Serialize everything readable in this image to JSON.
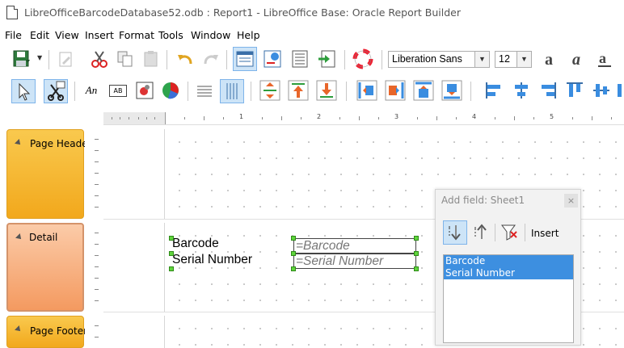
{
  "window": {
    "title": "LibreOfficeBarcodeDatabase52.odb : Report1 - LibreOffice Base: Oracle Report Builder"
  },
  "menubar": {
    "items": [
      "File",
      "Edit",
      "View",
      "Insert",
      "Format",
      "Tools",
      "Window",
      "Help"
    ]
  },
  "toolbar": {
    "font_name": "Liberation Sans",
    "font_size": "12",
    "text_field_label": "An",
    "label_field_label": "AB"
  },
  "ruler": {
    "numbers": [
      "1",
      "2",
      "3",
      "4",
      "5"
    ]
  },
  "sections": {
    "page_header": "Page Header",
    "detail": "Detail",
    "page_footer": "Page Footer"
  },
  "report": {
    "labels": [
      "Barcode",
      "Serial Number"
    ],
    "fields": [
      "=Barcode",
      "=Serial Number"
    ]
  },
  "add_field": {
    "title": "Add field: Sheet1",
    "close": "×",
    "insert_label": "Insert",
    "fields": [
      "Barcode",
      "Serial Number"
    ]
  },
  "colors": {
    "header_section": "#f5b52a",
    "detail_section": "#f6a06c",
    "footer_section": "#f5b52a",
    "selection": "#3d8fe0",
    "handle": "#5fd53c"
  }
}
